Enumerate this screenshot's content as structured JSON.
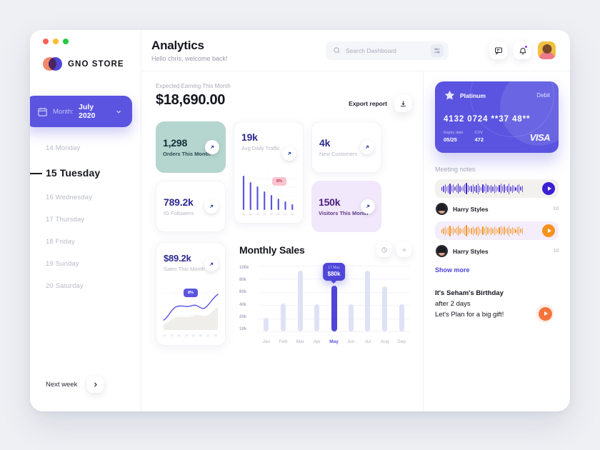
{
  "brand": {
    "name": "GNO STORE"
  },
  "sidebar": {
    "month_label": "Month:",
    "month_value": "July 2020",
    "calendar_icon": "calendar-icon",
    "chevron_icon": "chevron-down-icon",
    "days": [
      {
        "label": "14 Monday",
        "active": false
      },
      {
        "label": "15 Tuesday",
        "active": true
      },
      {
        "label": "16 Wednesday",
        "active": false
      },
      {
        "label": "17 Thursday",
        "active": false
      },
      {
        "label": "18 Friday",
        "active": false
      },
      {
        "label": "19 Sunday",
        "active": false
      },
      {
        "label": "20 Saturday",
        "active": false
      }
    ],
    "next_week": "Next week",
    "next_icon": "chevron-right-icon"
  },
  "header": {
    "title": "Analytics",
    "subtitle": "Hello chris, welcome back!",
    "search_placeholder": "Search Dashboard",
    "search_value": "",
    "search_icon": "search-icon",
    "filter_icon": "sliders-icon",
    "chat_icon": "chat-bubble-icon",
    "bell_icon": "bell-icon",
    "avatar": "user-avatar"
  },
  "earnings": {
    "label": "Expected Earning This Month",
    "value": "$18,690.00",
    "export_label": "Export report",
    "export_icon": "download-icon"
  },
  "stats": [
    {
      "num": "1,298",
      "cap": "Orders This Month",
      "theme": "teal"
    },
    {
      "num": "789.2k",
      "cap": "IG Followers",
      "theme": "white"
    },
    {
      "num": "19k",
      "cap": "Avg Daily Traffic",
      "theme": "white-tall",
      "badge": "8%"
    },
    {
      "num": "4k",
      "cap": "New Customers",
      "theme": "white"
    },
    {
      "num": "150k",
      "cap": "Visitors This Month",
      "theme": "purple"
    }
  ],
  "sales_card": {
    "num": "$89.2k",
    "cap": "Sales This Month",
    "badge": "8%"
  },
  "monthly": {
    "title": "Monthly Sales",
    "pie_icon": "pie-chart-icon",
    "add_icon": "plus-icon"
  },
  "credit_card": {
    "tier": "Platinum",
    "type": "Debit",
    "number": "4132 0724 **37 48**",
    "expiry_label": "Expiry date",
    "expiry_value": "05/25",
    "cvv_label": "CVV",
    "cvv_value": "472",
    "network": "VISA",
    "star_icon": "star-icon"
  },
  "notes": {
    "title": "Meeting notes",
    "items": [
      {
        "name": "Harry Styles",
        "time": "1d",
        "color": "#3b1fd4",
        "theme": "w1",
        "play": "play-icon"
      },
      {
        "name": "Harry Styles",
        "time": "1d",
        "color": "#f6921e",
        "theme": "w2",
        "play": "play-icon"
      }
    ],
    "show_more": "Show more"
  },
  "birthday": {
    "line1": "It's Seham's Birthday",
    "line2": "after 2 days",
    "line3": "Let's Plan for a big gift!",
    "play_icon": "play-icon"
  },
  "colors": {
    "accent": "#5a54e0",
    "accent_deep": "#4f46d9",
    "orange": "#f6921e",
    "teal": "#b5d5cf",
    "lilac": "#f1e8fb",
    "pink_badge": "#f9c3cf"
  },
  "chart_data": [
    {
      "type": "bar",
      "title": "Monthly Sales",
      "categories": [
        "Jan",
        "Feb",
        "Mar",
        "Apr",
        "May",
        "Jun",
        "Jul",
        "Aug",
        "Sep"
      ],
      "values": [
        22,
        45,
        97,
        43,
        73,
        43,
        97,
        72,
        43
      ],
      "highlight_index": 4,
      "yticks": [
        "10k",
        "20k",
        "40k",
        "60k",
        "80k",
        "100k"
      ],
      "ylim": [
        0,
        105
      ],
      "ylabel": "",
      "xlabel": "",
      "grid": true,
      "legend": "none",
      "tooltip": {
        "label": "17 May",
        "value": "$80k"
      }
    },
    {
      "type": "bar",
      "title": "Avg Daily Traffic",
      "categories": [
        "01",
        "02",
        "03",
        "04",
        "05",
        "06",
        "07",
        "08"
      ],
      "values": [
        100,
        78,
        66,
        52,
        42,
        33,
        24,
        15
      ],
      "annotation": "8%",
      "grid": true,
      "legend": "none"
    },
    {
      "type": "area",
      "title": "Sales This Month",
      "categories": [
        "01",
        "02",
        "03",
        "04",
        "05",
        "06",
        "07",
        "08"
      ],
      "series": [
        {
          "name": "Line",
          "values": [
            18,
            22,
            48,
            50,
            44,
            57,
            50,
            78
          ]
        },
        {
          "name": "Area",
          "values": [
            5,
            8,
            26,
            31,
            30,
            36,
            30,
            42
          ]
        }
      ],
      "annotation": "8%",
      "grid": true,
      "legend": "none"
    }
  ]
}
